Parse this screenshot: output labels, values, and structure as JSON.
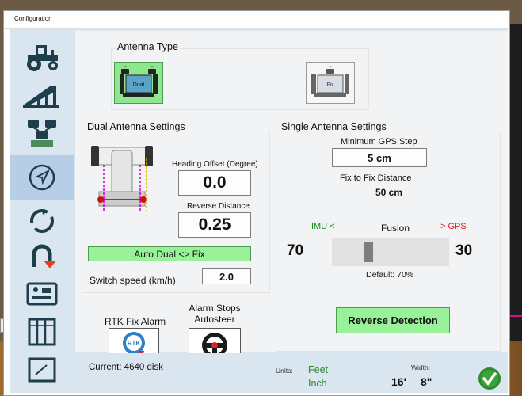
{
  "window": {
    "title": "Configuration"
  },
  "sidebar": {
    "items": [
      {
        "name": "vehicle"
      },
      {
        "name": "implement"
      },
      {
        "name": "antenna"
      },
      {
        "name": "navigation",
        "active": true
      },
      {
        "name": "steer-cycle"
      },
      {
        "name": "uturn"
      },
      {
        "name": "hardware"
      },
      {
        "name": "sections"
      },
      {
        "name": "field-tools"
      }
    ]
  },
  "antenna_type": {
    "label": "Antenna Type",
    "dual_label": "Dual",
    "fix_label": "Fix",
    "selected": "Dual"
  },
  "dual": {
    "title": "Dual Antenna Settings",
    "heading_offset_label": "Heading Offset (Degree)",
    "heading_offset_value": "0.0",
    "reverse_distance_label": "Reverse Distance",
    "reverse_distance_value": "0.25",
    "auto_button": "Auto Dual <> Fix",
    "switch_speed_label": "Switch speed (km/h)",
    "switch_speed_value": "2.0"
  },
  "single": {
    "title": "Single Antenna Settings",
    "min_gps_step_label": "Minimum GPS Step",
    "min_gps_step_value": "5 cm",
    "fix_to_fix_label": "Fix to Fix Distance",
    "fix_to_fix_value": "50 cm",
    "imu_label": "IMU <",
    "fusion_label": "Fusion",
    "gps_label": "> GPS",
    "imu_value": "70",
    "gps_value": "30",
    "fusion_fraction": 0.7,
    "default_label": "Default: 70%",
    "reverse_detection": "Reverse Detection"
  },
  "alarms": {
    "rtk_label": "RTK Fix Alarm",
    "rtk_badge": "RTK",
    "stop_label_1": "Alarm Stops",
    "stop_label_2": "Autosteer"
  },
  "status": {
    "current": "Current: 4640 disk",
    "units_label": "Units:",
    "units_feet": "Feet",
    "units_inch": "Inch",
    "width_label": "Width:",
    "width_feet": "16'",
    "width_inch": "8\""
  },
  "colors": {
    "accent_green": "#99f199",
    "imu_green": "#1b8a1b",
    "gps_red": "#e01c1c",
    "units_green": "#2e8b2e"
  }
}
